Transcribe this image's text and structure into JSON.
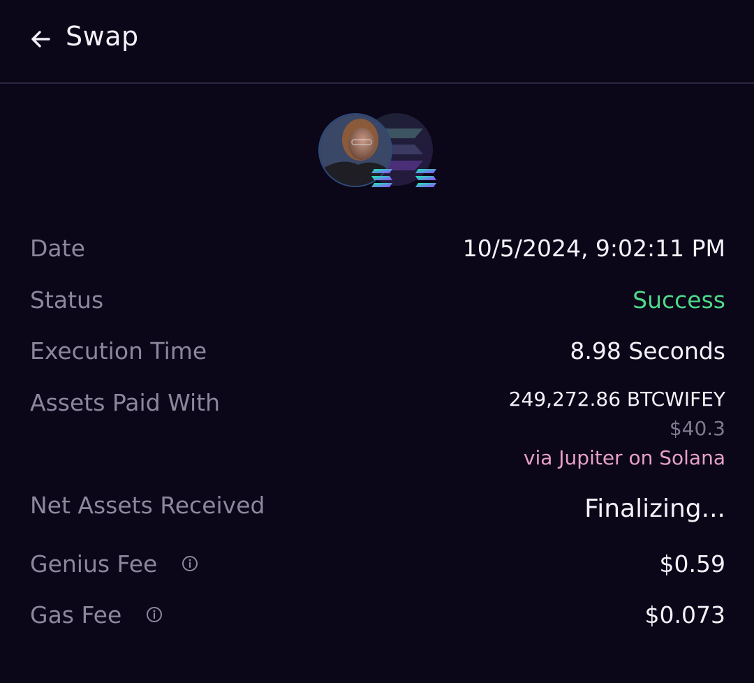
{
  "header": {
    "title": "Swap",
    "back_icon": "arrow-left-icon"
  },
  "tokens": {
    "from_icon": "token-avatar-icon",
    "to_icon": "solana-logo-icon",
    "chain_icon": "solana-chain-icon",
    "solana_gradient": [
      "#14f1b0",
      "#9945ff"
    ]
  },
  "details": {
    "date": {
      "label": "Date",
      "value": "10/5/2024, 9:02:11 PM"
    },
    "status": {
      "label": "Status",
      "value": "Success",
      "color": "#4fd98a"
    },
    "execution_time": {
      "label": "Execution Time",
      "value": "8.98 Seconds"
    },
    "assets_paid": {
      "label": "Assets Paid With",
      "amount": "249,272.86 BTCWIFEY",
      "usd": "$40.3",
      "route": "via Jupiter on Solana"
    },
    "net_received": {
      "label": "Net Assets Received",
      "value": "Finalizing..."
    },
    "genius_fee": {
      "label": "Genius Fee",
      "value": "$0.59",
      "icon": "info-icon"
    },
    "gas_fee": {
      "label": "Gas Fee",
      "value": "$0.073",
      "icon": "info-icon"
    }
  }
}
